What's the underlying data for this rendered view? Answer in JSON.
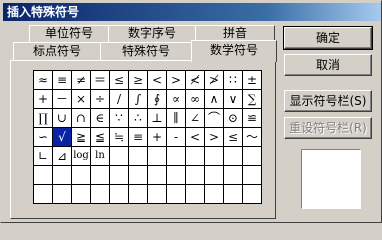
{
  "window": {
    "title": "插入特殊符号"
  },
  "tabs": {
    "row1": [
      "单位符号",
      "数字序号",
      "拼音"
    ],
    "row2": [
      "标点符号",
      "特殊符号",
      "数学符号"
    ],
    "active": "数学符号"
  },
  "buttons": {
    "ok": "确定",
    "cancel": "取消",
    "show_toolbar": "显示符号栏(S)",
    "reset_toolbar": "重设符号栏(R)"
  },
  "symbols": [
    [
      "≈",
      "≡",
      "≠",
      "＝",
      "≤",
      "≥",
      "<",
      ">",
      "≮",
      "≯",
      "∷",
      "±"
    ],
    [
      "+",
      "－",
      "×",
      "÷",
      "/",
      "∫",
      "∮",
      "∝",
      "∞",
      "∧",
      "∨",
      "∑"
    ],
    [
      "∏",
      "∪",
      "∩",
      "∈",
      "∵",
      "∴",
      "⊥",
      "∥",
      "∠",
      "⌒",
      "⊙",
      "≌"
    ],
    [
      "∽",
      "√",
      "≧",
      "≦",
      "≒",
      "≡",
      "+",
      "-",
      "<",
      ">",
      "≤",
      "～"
    ],
    [
      "∟",
      "⊿",
      "log",
      "ln",
      "",
      "",
      "",
      "",
      "",
      "",
      "",
      ""
    ],
    [
      "",
      "",
      "",
      "",
      "",
      "",
      "",
      "",
      "",
      "",
      "",
      ""
    ],
    [
      "",
      "",
      "",
      "",
      "",
      "",
      "",
      "",
      "",
      "",
      "",
      ""
    ]
  ],
  "selected_symbol": "√",
  "colors": {
    "titlebar": "#0a246a",
    "selection": "#0a24a6",
    "face": "#d4d0c8"
  }
}
